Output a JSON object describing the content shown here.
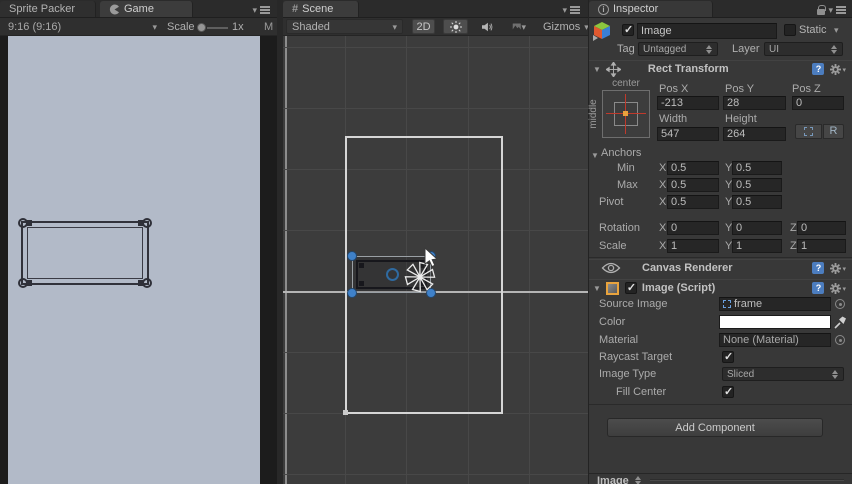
{
  "game_panel": {
    "tab_sprite_packer": "Sprite Packer",
    "tab_game": "Game",
    "aspect": "9:16 (9:16)",
    "scale_label": "Scale",
    "scale_value": "1x",
    "maximize_clipped": "M"
  },
  "scene_panel": {
    "tab": "Scene",
    "shading": "Shaded",
    "btn_2d": "2D",
    "gizmos": "Gizmos"
  },
  "inspector": {
    "tab": "Inspector",
    "name": "Image",
    "static_label": "Static",
    "tag_label": "Tag",
    "tag_value": "Untagged",
    "layer_label": "Layer",
    "layer_value": "UI",
    "axis": {
      "x": "X",
      "y": "Y",
      "z": "Z"
    },
    "rect_transform": {
      "title": "Rect Transform",
      "anchor_h": "center",
      "anchor_v": "middle",
      "pos_x_label": "Pos X",
      "pos_y_label": "Pos Y",
      "pos_z_label": "Pos Z",
      "pos_x": "-213",
      "pos_y": "28",
      "pos_z": "0",
      "width_label": "Width",
      "height_label": "Height",
      "width": "547",
      "height": "264",
      "r_button": "R",
      "anchors_title": "Anchors",
      "min_label": "Min",
      "min_x": "0.5",
      "min_y": "0.5",
      "max_label": "Max",
      "max_x": "0.5",
      "max_y": "0.5",
      "pivot_label": "Pivot",
      "pivot_x": "0.5",
      "pivot_y": "0.5",
      "rotation_label": "Rotation",
      "rotation_x": "0",
      "rotation_y": "0",
      "rotation_z": "0",
      "scale_label": "Scale",
      "scale_x": "1",
      "scale_y": "1",
      "scale_z": "1"
    },
    "canvas_renderer_title": "Canvas Renderer",
    "image_component": {
      "title": "Image (Script)",
      "source_image_label": "Source Image",
      "source_image": "frame",
      "color_label": "Color",
      "material_label": "Material",
      "material": "None (Material)",
      "raycast_label": "Raycast Target",
      "image_type_label": "Image Type",
      "image_type": "Sliced",
      "fill_center_label": "Fill Center"
    },
    "add_component": "Add Component",
    "preview_title": "Image"
  },
  "colors": {
    "accent_blue": "#3f81c9",
    "help_blue": "#4c7dbf",
    "game_viewport_bg": "#b2bac8",
    "scene_bg": "#3c3c3c",
    "panel_bg": "#383838"
  }
}
